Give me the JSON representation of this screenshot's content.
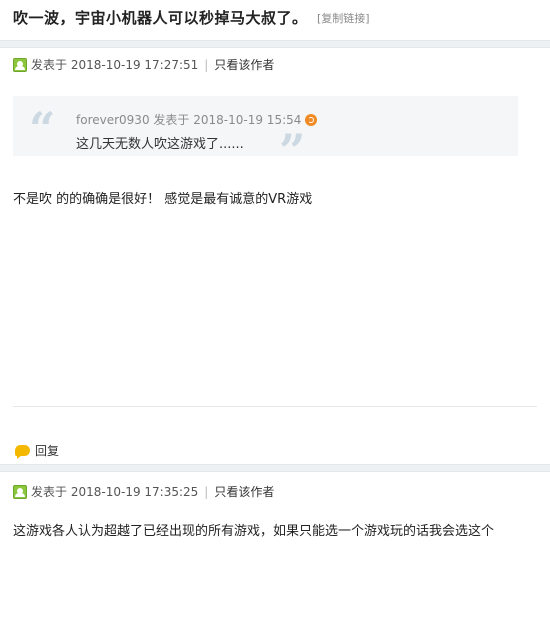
{
  "thread": {
    "title": "吹一波，宇宙小机器人可以秒掉马大叔了。",
    "copy_link": "[复制链接]"
  },
  "posts": [
    {
      "posted_label": "发表于",
      "timestamp": "2018-10-19 17:27:51",
      "only_author": "只看该作者",
      "quote": {
        "author": "forever0930",
        "posted_label": "发表于",
        "timestamp": "2018-10-19 15:54",
        "text": "这几天无数人吹这游戏了......"
      },
      "body": "不是吹 的的确确是很好！ 感觉是最有诚意的VR游戏",
      "reply_label": "回复"
    },
    {
      "posted_label": "发表于",
      "timestamp": "2018-10-19 17:35:25",
      "only_author": "只看该作者",
      "body": "这游戏各人认为超越了已经出现的所有游戏，如果只能选一个游戏玩的话我会选这个"
    }
  ],
  "icons": {
    "author": "user-icon",
    "goto": "goto-post-icon",
    "reply": "reply-bubble-icon"
  },
  "colors": {
    "author_icon": "#8cc63e",
    "goto_icon": "#f08a24",
    "reply_icon": "#f5b800",
    "quote_bg": "#f4f6f8"
  }
}
